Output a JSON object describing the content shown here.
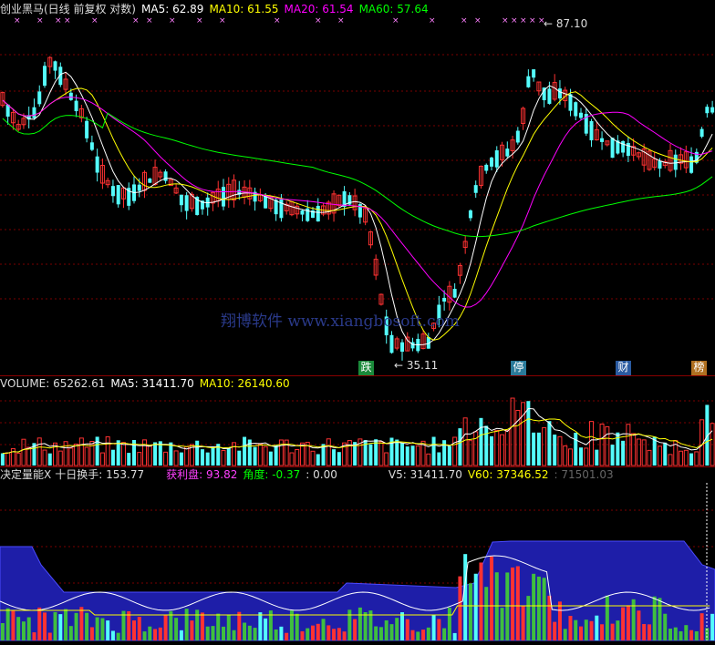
{
  "colors": {
    "up": "#ff3232",
    "down": "#54fcfc",
    "ma5": "#ffffff",
    "ma10": "#ffff00",
    "ma20": "#ff00ff",
    "ma60": "#00ff00",
    "grid": "#7a0000",
    "marker": "#ff80ff",
    "watermark": "#2a3a8a",
    "band": "#1e1ea8",
    "green_bar": "#3fbf3f",
    "label_box": "#1a6b3a"
  },
  "price_panel": {
    "title": "创业黑马(日线 前复权 对数)",
    "ma5": {
      "label": "MA5:",
      "value": "62.89"
    },
    "ma10": {
      "label": "MA10:",
      "value": "61.55"
    },
    "ma20": {
      "label": "MA20:",
      "value": "61.54"
    },
    "ma60": {
      "label": "MA60:",
      "value": "57.64"
    },
    "high_label": "87.10",
    "low_label": "35.11",
    "watermark": "翔博软件 www.xiangbosoft.com",
    "event_tags": [
      {
        "text": "跌",
        "color": "#1a8a3a"
      },
      {
        "text": "停",
        "color": "#2a7a9a"
      },
      {
        "text": "财",
        "color": "#2a5aa0"
      },
      {
        "text": "榜",
        "color": "#b07020"
      }
    ]
  },
  "volume_panel": {
    "label": "VOLUME:",
    "value": "65262.61",
    "ma5": {
      "label": "MA5:",
      "value": "31411.70"
    },
    "ma10": {
      "label": "MA10:",
      "value": "26140.60"
    }
  },
  "indicator_panel": {
    "name": "决定量能X",
    "turnover": {
      "label": "十日换手:",
      "value": "153.77"
    },
    "profit": {
      "label": "获利盘:",
      "value": "93.82"
    },
    "angle": {
      "label": "角度:",
      "value": "-0.37"
    },
    "extra": ": 0.00",
    "v5": {
      "label": "V5:",
      "value": "31411.70"
    },
    "v60": {
      "label": "V60:",
      "value": "37346.52"
    },
    "dim": ": 71501.03"
  },
  "chart_data": {
    "type": "candlestick",
    "price_scale": "log",
    "price_range": [
      33,
      92
    ],
    "high_point": 87.1,
    "low_point": 35.11,
    "bars": 136
  }
}
